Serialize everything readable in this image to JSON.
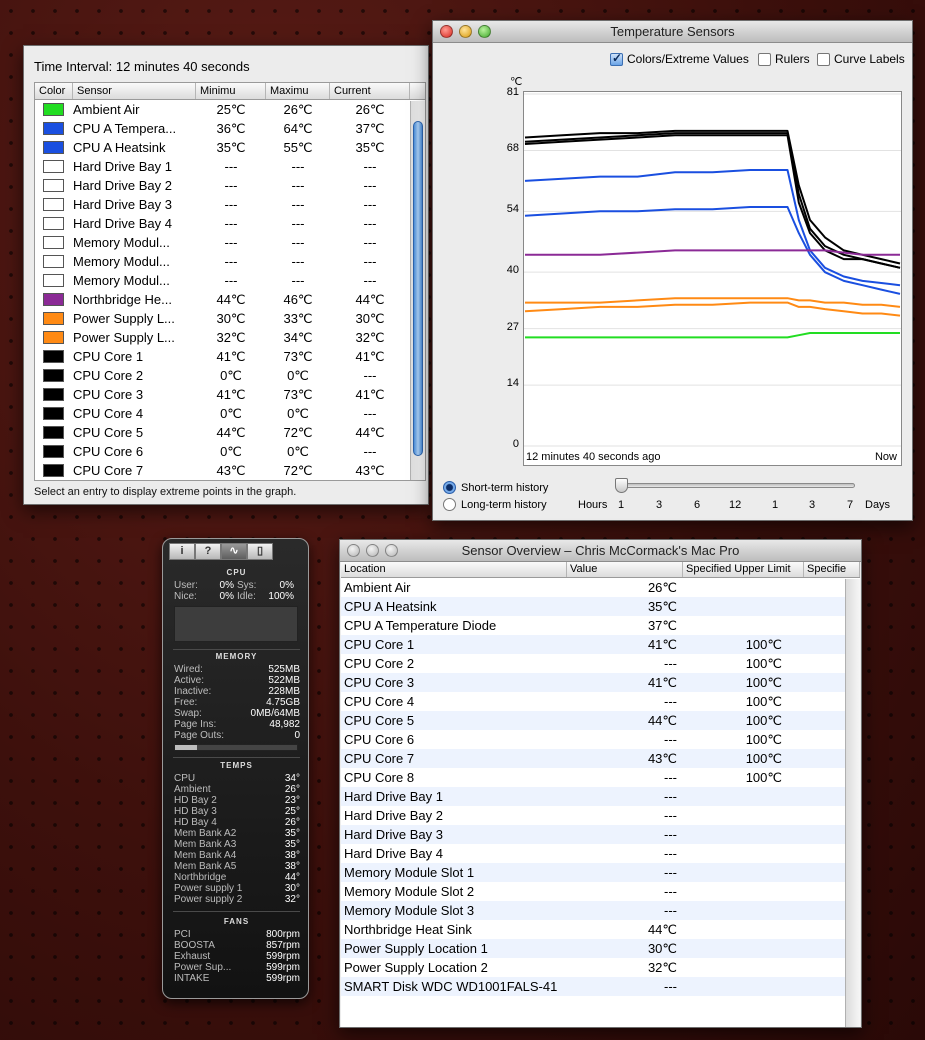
{
  "sensors_window": {
    "interval_label": "Time Interval: 12 minutes 40 seconds",
    "columns": [
      "Color",
      "Sensor",
      "Minimu",
      "Maximu",
      "Current"
    ],
    "rows": [
      {
        "color": "#22dd22",
        "name": "Ambient Air",
        "min": "25℃",
        "max": "26℃",
        "cur": "26℃"
      },
      {
        "color": "#1a4fe0",
        "name": "CPU A Tempera...",
        "min": "36℃",
        "max": "64℃",
        "cur": "37℃"
      },
      {
        "color": "#1a4fe0",
        "name": "CPU A Heatsink",
        "min": "35℃",
        "max": "55℃",
        "cur": "35℃"
      },
      {
        "color": "#ffffff",
        "name": "Hard Drive Bay 1",
        "min": "---",
        "max": "---",
        "cur": "---"
      },
      {
        "color": "#ffffff",
        "name": "Hard Drive Bay 2",
        "min": "---",
        "max": "---",
        "cur": "---"
      },
      {
        "color": "#ffffff",
        "name": "Hard Drive Bay 3",
        "min": "---",
        "max": "---",
        "cur": "---"
      },
      {
        "color": "#ffffff",
        "name": "Hard Drive Bay 4",
        "min": "---",
        "max": "---",
        "cur": "---"
      },
      {
        "color": "#ffffff",
        "name": "Memory Modul...",
        "min": "---",
        "max": "---",
        "cur": "---"
      },
      {
        "color": "#ffffff",
        "name": "Memory Modul...",
        "min": "---",
        "max": "---",
        "cur": "---"
      },
      {
        "color": "#ffffff",
        "name": "Memory Modul...",
        "min": "---",
        "max": "---",
        "cur": "---"
      },
      {
        "color": "#8b2a96",
        "name": "Northbridge He...",
        "min": "44℃",
        "max": "46℃",
        "cur": "44℃"
      },
      {
        "color": "#ff8a14",
        "name": "Power Supply L...",
        "min": "30℃",
        "max": "33℃",
        "cur": "30℃"
      },
      {
        "color": "#ff8a14",
        "name": "Power Supply L...",
        "min": "32℃",
        "max": "34℃",
        "cur": "32℃"
      },
      {
        "color": "#000000",
        "name": "CPU Core 1",
        "min": "41℃",
        "max": "73℃",
        "cur": "41℃"
      },
      {
        "color": "#000000",
        "name": "CPU Core 2",
        "min": "0℃",
        "max": "0℃",
        "cur": "---"
      },
      {
        "color": "#000000",
        "name": "CPU Core 3",
        "min": "41℃",
        "max": "73℃",
        "cur": "41℃"
      },
      {
        "color": "#000000",
        "name": "CPU Core 4",
        "min": "0℃",
        "max": "0℃",
        "cur": "---"
      },
      {
        "color": "#000000",
        "name": "CPU Core 5",
        "min": "44℃",
        "max": "72℃",
        "cur": "44℃"
      },
      {
        "color": "#000000",
        "name": "CPU Core 6",
        "min": "0℃",
        "max": "0℃",
        "cur": "---"
      },
      {
        "color": "#000000",
        "name": "CPU Core 7",
        "min": "43℃",
        "max": "72℃",
        "cur": "43℃"
      }
    ],
    "status": "Select an entry to display extreme points in the graph."
  },
  "graph_window": {
    "title": "Temperature Sensors",
    "opt_colors": "Colors/Extreme Values",
    "opt_rulers": "Rulers",
    "opt_curves": "Curve Labels",
    "unit": "℃",
    "x_left_label": "12 minutes 40 seconds ago",
    "x_right_label": "Now",
    "radio_short": "Short-term history",
    "radio_long": "Long-term history",
    "hours_label": "Hours",
    "days_label": "Days",
    "slider_ticks": [
      "1",
      "3",
      "6",
      "12",
      "1",
      "3",
      "7"
    ]
  },
  "chart_data": {
    "type": "line",
    "ylim": [
      0,
      81
    ],
    "y_ticks": [
      0,
      14,
      27,
      40,
      54,
      68,
      81
    ],
    "x": [
      0,
      10,
      20,
      30,
      40,
      50,
      60,
      70,
      73,
      76,
      80,
      85,
      90,
      95,
      100
    ],
    "series": [
      {
        "color": "#000000",
        "values": [
          71,
          71.5,
          72,
          72,
          72.5,
          72.5,
          72.5,
          72.5,
          60,
          52,
          48,
          45,
          44,
          43,
          42
        ]
      },
      {
        "color": "#000000",
        "values": [
          70,
          70.5,
          71,
          71.5,
          72,
          72,
          72,
          72,
          58,
          50,
          46,
          44,
          43,
          42,
          41
        ]
      },
      {
        "color": "#000000",
        "values": [
          69.5,
          70,
          70.5,
          71,
          71.5,
          71.5,
          71.5,
          71.5,
          56,
          49,
          45,
          43,
          43,
          42,
          41
        ]
      },
      {
        "color": "#1a4fe0",
        "values": [
          61,
          61.5,
          62,
          62,
          63,
          63,
          63.5,
          63.5,
          52,
          45,
          41,
          39,
          38,
          37.5,
          37
        ]
      },
      {
        "color": "#1a4fe0",
        "values": [
          53,
          53.5,
          54,
          54,
          54.5,
          54.5,
          55,
          55,
          49,
          44,
          40,
          38,
          37,
          36,
          35
        ]
      },
      {
        "color": "#8b2a96",
        "values": [
          44,
          44,
          44,
          44.5,
          45,
          45,
          45,
          45,
          45,
          45,
          45,
          44.5,
          44,
          44,
          44
        ]
      },
      {
        "color": "#ff8a14",
        "values": [
          33,
          33,
          33,
          33.5,
          34,
          34,
          34,
          34,
          33.5,
          33.5,
          33,
          33,
          32.5,
          32.5,
          32
        ]
      },
      {
        "color": "#ff8a14",
        "values": [
          31,
          31.5,
          32,
          32,
          32.5,
          32.5,
          33,
          33,
          32,
          32,
          31.5,
          31,
          30.5,
          30.5,
          30
        ]
      },
      {
        "color": "#22dd22",
        "values": [
          25,
          25,
          25,
          25,
          25,
          25,
          25,
          25,
          25.5,
          26,
          26,
          26,
          26,
          26,
          26
        ]
      }
    ]
  },
  "widget": {
    "tabs": [
      "i",
      "?",
      "∿",
      "▯"
    ],
    "cpu_title": "CPU",
    "cpu_user_label": "User:",
    "cpu_user": "0%",
    "cpu_sys_label": "Sys:",
    "cpu_sys": "0%",
    "cpu_nice_label": "Nice:",
    "cpu_nice": "0%",
    "cpu_idle_label": "Idle:",
    "cpu_idle": "100%",
    "memory_title": "MEMORY",
    "memory": [
      {
        "label": "Wired:",
        "value": "525MB"
      },
      {
        "label": "Active:",
        "value": "522MB"
      },
      {
        "label": "Inactive:",
        "value": "228MB"
      },
      {
        "label": "Free:",
        "value": "4.75GB"
      },
      {
        "label": "Swap:",
        "value": "0MB/64MB"
      },
      {
        "label": "Page Ins:",
        "value": "48,982"
      },
      {
        "label": "Page Outs:",
        "value": "0"
      }
    ],
    "temps_title": "TEMPS",
    "temps": [
      {
        "label": "CPU",
        "value": "34°"
      },
      {
        "label": "Ambient",
        "value": "26°"
      },
      {
        "label": "HD Bay 2",
        "value": "23°"
      },
      {
        "label": "HD Bay 3",
        "value": "25°"
      },
      {
        "label": "HD Bay 4",
        "value": "26°"
      },
      {
        "label": "Mem Bank A2",
        "value": "35°"
      },
      {
        "label": "Mem Bank A3",
        "value": "35°"
      },
      {
        "label": "Mem Bank A4",
        "value": "38°"
      },
      {
        "label": "Mem Bank A5",
        "value": "38°"
      },
      {
        "label": "Northbridge",
        "value": "44°"
      },
      {
        "label": "Power supply 1",
        "value": "30°"
      },
      {
        "label": "Power supply 2",
        "value": "32°"
      }
    ],
    "fans_title": "FANS",
    "fans": [
      {
        "label": "PCI",
        "value": "800rpm"
      },
      {
        "label": "BOOSTA",
        "value": "857rpm"
      },
      {
        "label": "Exhaust",
        "value": "599rpm"
      },
      {
        "label": "Power Sup...",
        "value": "599rpm"
      },
      {
        "label": "INTAKE",
        "value": "599rpm"
      }
    ]
  },
  "overview_window": {
    "title": "Sensor Overview – Chris McCormack's Mac Pro",
    "columns": [
      "Location",
      "Value",
      "Specified Upper Limit",
      "Specifie"
    ],
    "rows": [
      {
        "loc": "Ambient Air",
        "val": "26℃",
        "lim": ""
      },
      {
        "loc": "CPU A Heatsink",
        "val": "35℃",
        "lim": ""
      },
      {
        "loc": "CPU A Temperature Diode",
        "val": "37℃",
        "lim": ""
      },
      {
        "loc": "CPU Core 1",
        "val": "41℃",
        "lim": "100℃"
      },
      {
        "loc": "CPU Core 2",
        "val": "---",
        "lim": "100℃"
      },
      {
        "loc": "CPU Core 3",
        "val": "41℃",
        "lim": "100℃"
      },
      {
        "loc": "CPU Core 4",
        "val": "---",
        "lim": "100℃"
      },
      {
        "loc": "CPU Core 5",
        "val": "44℃",
        "lim": "100℃"
      },
      {
        "loc": "CPU Core 6",
        "val": "---",
        "lim": "100℃"
      },
      {
        "loc": "CPU Core 7",
        "val": "43℃",
        "lim": "100℃"
      },
      {
        "loc": "CPU Core 8",
        "val": "---",
        "lim": "100℃"
      },
      {
        "loc": "Hard Drive Bay 1",
        "val": "---",
        "lim": ""
      },
      {
        "loc": "Hard Drive Bay 2",
        "val": "---",
        "lim": ""
      },
      {
        "loc": "Hard Drive Bay 3",
        "val": "---",
        "lim": ""
      },
      {
        "loc": "Hard Drive Bay 4",
        "val": "---",
        "lim": ""
      },
      {
        "loc": "Memory Module Slot 1",
        "val": "---",
        "lim": ""
      },
      {
        "loc": "Memory Module Slot 2",
        "val": "---",
        "lim": ""
      },
      {
        "loc": "Memory Module Slot 3",
        "val": "---",
        "lim": ""
      },
      {
        "loc": "Northbridge Heat Sink",
        "val": "44℃",
        "lim": ""
      },
      {
        "loc": "Power Supply Location 1",
        "val": "30℃",
        "lim": ""
      },
      {
        "loc": "Power Supply Location 2",
        "val": "32℃",
        "lim": ""
      },
      {
        "loc": "SMART Disk WDC WD1001FALS-41",
        "val": "---",
        "lim": ""
      }
    ]
  }
}
